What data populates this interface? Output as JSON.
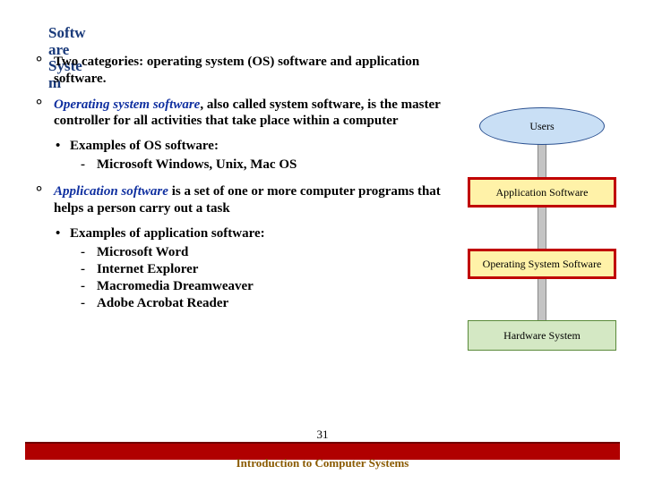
{
  "title": "Software System",
  "bullets": {
    "b1": "Two categories:  operating system (OS) software and application software.",
    "b2_blue": "Operating system software",
    "b2_rest": ", also called system software, is the master controller for all activities that take place within a computer",
    "b2_sub": "Examples of OS software:",
    "b2_ex1": "Microsoft Windows, Unix, Mac OS",
    "b3_blue": "Application software",
    "b3_rest": " is a set of one or more computer programs that helps a person carry out a task",
    "b3_sub": "Examples of application software:",
    "b3_ex1": "Microsoft Word",
    "b3_ex2": "Internet Explorer",
    "b3_ex3": "Macromedia Dreamweaver",
    "b3_ex4": "Adobe Acrobat Reader"
  },
  "diagram": {
    "users": "Users",
    "app": "Application Software",
    "os": "Operating System Software",
    "hw": "Hardware System"
  },
  "footer": "Introduction to Computer Systems",
  "page": "31"
}
